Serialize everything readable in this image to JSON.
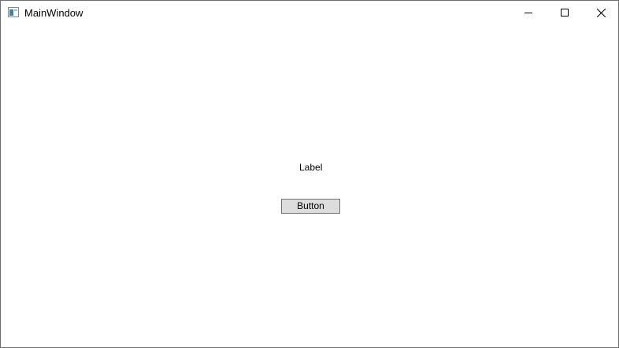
{
  "window": {
    "title": "MainWindow",
    "icon": "app-window-icon"
  },
  "titlebar": {
    "buttons": [
      {
        "name": "minimize",
        "icon": "minimize-icon"
      },
      {
        "name": "maximize",
        "icon": "maximize-icon"
      },
      {
        "name": "close",
        "icon": "close-icon"
      }
    ]
  },
  "content": {
    "label_text": "Label",
    "button_label": "Button"
  },
  "colors": {
    "button_background": "#dddddd",
    "button_border": "#707070",
    "window_border": "#6d6d6d"
  }
}
